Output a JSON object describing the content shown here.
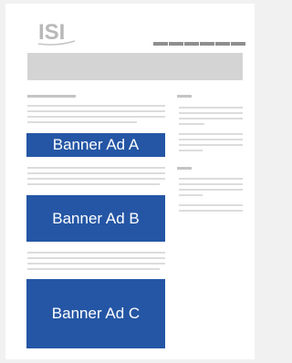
{
  "header": {
    "logo_text": "ISI"
  },
  "ads": {
    "banner_a": "Banner Ad A",
    "banner_b": "Banner Ad B",
    "banner_c": "Banner Ad C"
  },
  "colors": {
    "ad_background": "#2456a5",
    "ad_text": "#ffffff",
    "logo": "#b8b8b8",
    "nav": "#8f8f8f",
    "placeholder": "#d4d4d4"
  }
}
